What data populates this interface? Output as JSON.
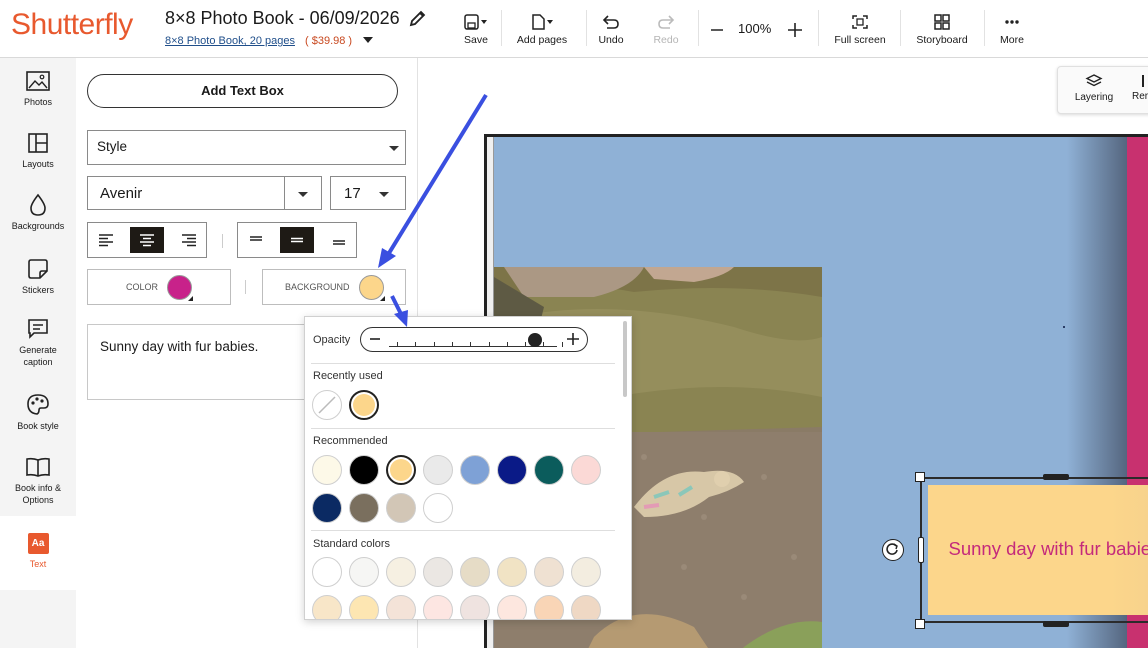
{
  "header": {
    "logo": "Shutterfly",
    "title": "8×8 Photo Book - 06/09/2026",
    "subtitle": "8×8 Photo Book, 20 pages",
    "price": "( $39.98 )",
    "tools": {
      "save": "Save",
      "add_pages": "Add pages",
      "undo": "Undo",
      "redo": "Redo",
      "zoom": "100%",
      "full_screen": "Full screen",
      "storyboard": "Storyboard",
      "more": "More"
    }
  },
  "nav": {
    "photos": "Photos",
    "layouts": "Layouts",
    "backgrounds": "Backgrounds",
    "stickers": "Stickers",
    "generate_caption_1": "Generate",
    "generate_caption_2": "caption",
    "book_style": "Book style",
    "book_info_1": "Book info &",
    "book_info_2": "Options",
    "text": "Text",
    "text_icon": "Aa"
  },
  "panel": {
    "add_text_box": "Add Text Box",
    "style": "Style",
    "font": "Avenir",
    "font_size": "17",
    "color_label": "COLOR",
    "background_label": "BACKGROUND",
    "text_value": "Sunny day with fur babies.",
    "text_color": "#c8228a",
    "background_color": "#fcd68b"
  },
  "canvas": {
    "layering": "Layering",
    "remove_partial": "Rer",
    "textbox_text": "Sunny day with fur babies."
  },
  "popup": {
    "opacity_label": "Opacity",
    "opacity_percent": 87,
    "recently_used_label": "Recently used",
    "recently_used": [
      "none",
      "#fcd68b"
    ],
    "recommended_label": "Recommended",
    "recommended": [
      "#fdf9e8",
      "#000000",
      "#fcd68b",
      "#eaeaea",
      "#7ea1d6",
      "#0a1a87",
      "#0b5c5c",
      "#fbd9d6",
      "#0b2a63",
      "#7a6f5e",
      "#d2c6b6",
      "#ffffff"
    ],
    "standard_label": "Standard colors",
    "standard": [
      "#ffffff",
      "#f6f6f4",
      "#f6f0e2",
      "#ebe7e3",
      "#e6dcc6",
      "#f1e3c4",
      "#efe1d2",
      "#f3ede0",
      "#f8e6c8",
      "#fde6b2",
      "#f4e3d8",
      "#fde6e2",
      "#efe3e0",
      "#fde7df",
      "#f9d5b6",
      "#efd8c4"
    ]
  }
}
